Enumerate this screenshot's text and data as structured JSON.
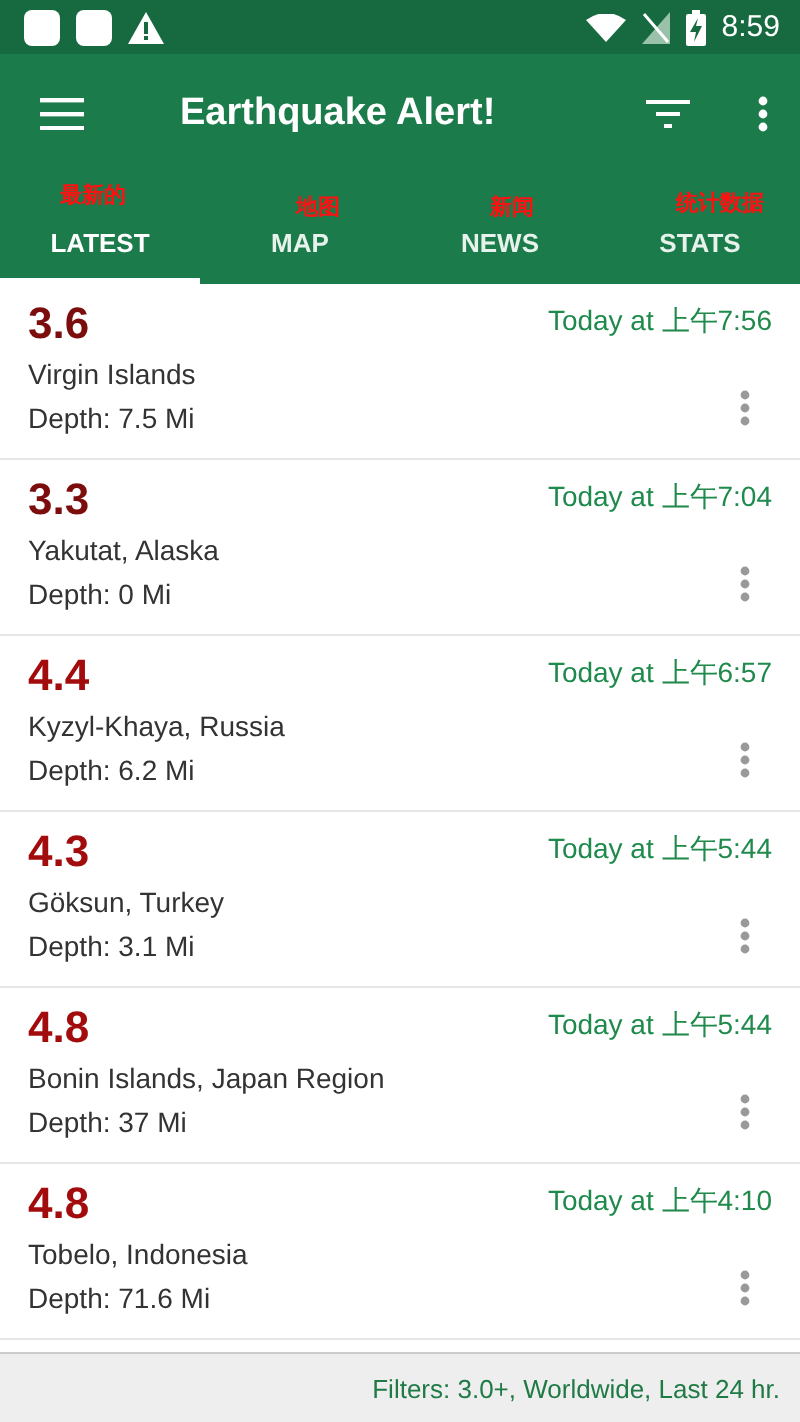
{
  "status_bar": {
    "time": "8:59"
  },
  "app_bar": {
    "title": "Earthquake Alert!"
  },
  "tabs": [
    {
      "label": "LATEST",
      "selected": true,
      "annotation": "最新的"
    },
    {
      "label": "MAP",
      "selected": false,
      "annotation": "地图"
    },
    {
      "label": "NEWS",
      "selected": false,
      "annotation": "新闻"
    },
    {
      "label": "STATS",
      "selected": false,
      "annotation": "统计数据"
    }
  ],
  "quakes": [
    {
      "magnitude": "3.6",
      "color": "#7b0d0d",
      "place": "Virgin Islands",
      "depth": "Depth: 7.5 Mi",
      "time": "Today at 上午7:56"
    },
    {
      "magnitude": "3.3",
      "color": "#7b0d0d",
      "place": "Yakutat, Alaska",
      "depth": "Depth: 0 Mi",
      "time": "Today at 上午7:04"
    },
    {
      "magnitude": "4.4",
      "color": "#a30c0c",
      "place": "Kyzyl-Khaya, Russia",
      "depth": "Depth: 6.2 Mi",
      "time": "Today at 上午6:57"
    },
    {
      "magnitude": "4.3",
      "color": "#a30c0c",
      "place": "Göksun, Turkey",
      "depth": "Depth: 3.1 Mi",
      "time": "Today at 上午5:44"
    },
    {
      "magnitude": "4.8",
      "color": "#a30c0c",
      "place": "Bonin Islands, Japan Region",
      "depth": "Depth: 37 Mi",
      "time": "Today at 上午5:44"
    },
    {
      "magnitude": "4.8",
      "color": "#a30c0c",
      "place": "Tobelo, Indonesia",
      "depth": "Depth: 71.6 Mi",
      "time": "Today at 上午4:10"
    }
  ],
  "footer": {
    "filters": "Filters: 3.0+, Worldwide, Last 24 hr."
  }
}
